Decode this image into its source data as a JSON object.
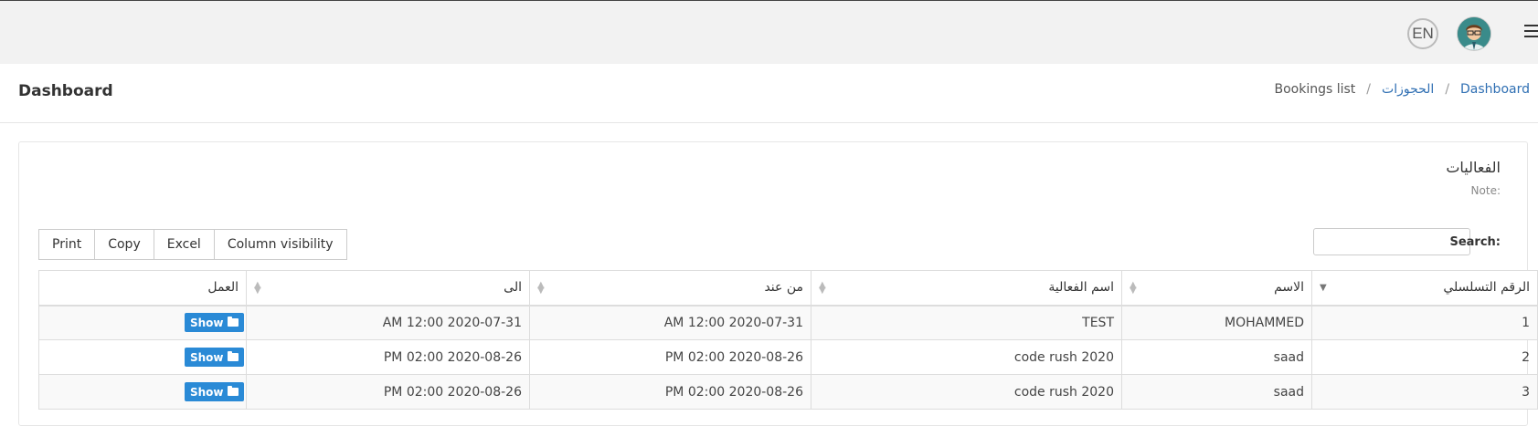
{
  "topbar": {
    "lang_label": "EN"
  },
  "header": {
    "title": "Dashboard",
    "breadcrumb": [
      "Dashboard",
      "الحجوزات",
      "Bookings list"
    ]
  },
  "panel": {
    "title": "الفعاليات",
    "note": "Note:",
    "buttons": [
      "Print",
      "Copy",
      "Excel",
      "Column visibility"
    ],
    "search_label": "Search:",
    "search_value": ""
  },
  "table": {
    "columns": [
      "الرقم التسلسلي",
      "الاسم",
      "اسم الفعالية",
      "من عند",
      "الى",
      "العمل"
    ],
    "rows": [
      {
        "id": "1",
        "name": "MOHAMMED",
        "event": "TEST",
        "from": "2020-07-31 12:00 AM",
        "to": "2020-07-31 12:00 AM",
        "action": "Show"
      },
      {
        "id": "2",
        "name": "saad",
        "event": "code rush 2020",
        "from": "2020-08-26 02:00 PM",
        "to": "2020-08-26 02:00 PM",
        "action": "Show"
      },
      {
        "id": "3",
        "name": "saad",
        "event": "code rush 2020",
        "from": "2020-08-26 02:00 PM",
        "to": "2020-08-26 02:00 PM",
        "action": "Show"
      }
    ]
  },
  "colors": {
    "link": "#2f6fb3",
    "show_button": "#2a8ad6"
  }
}
